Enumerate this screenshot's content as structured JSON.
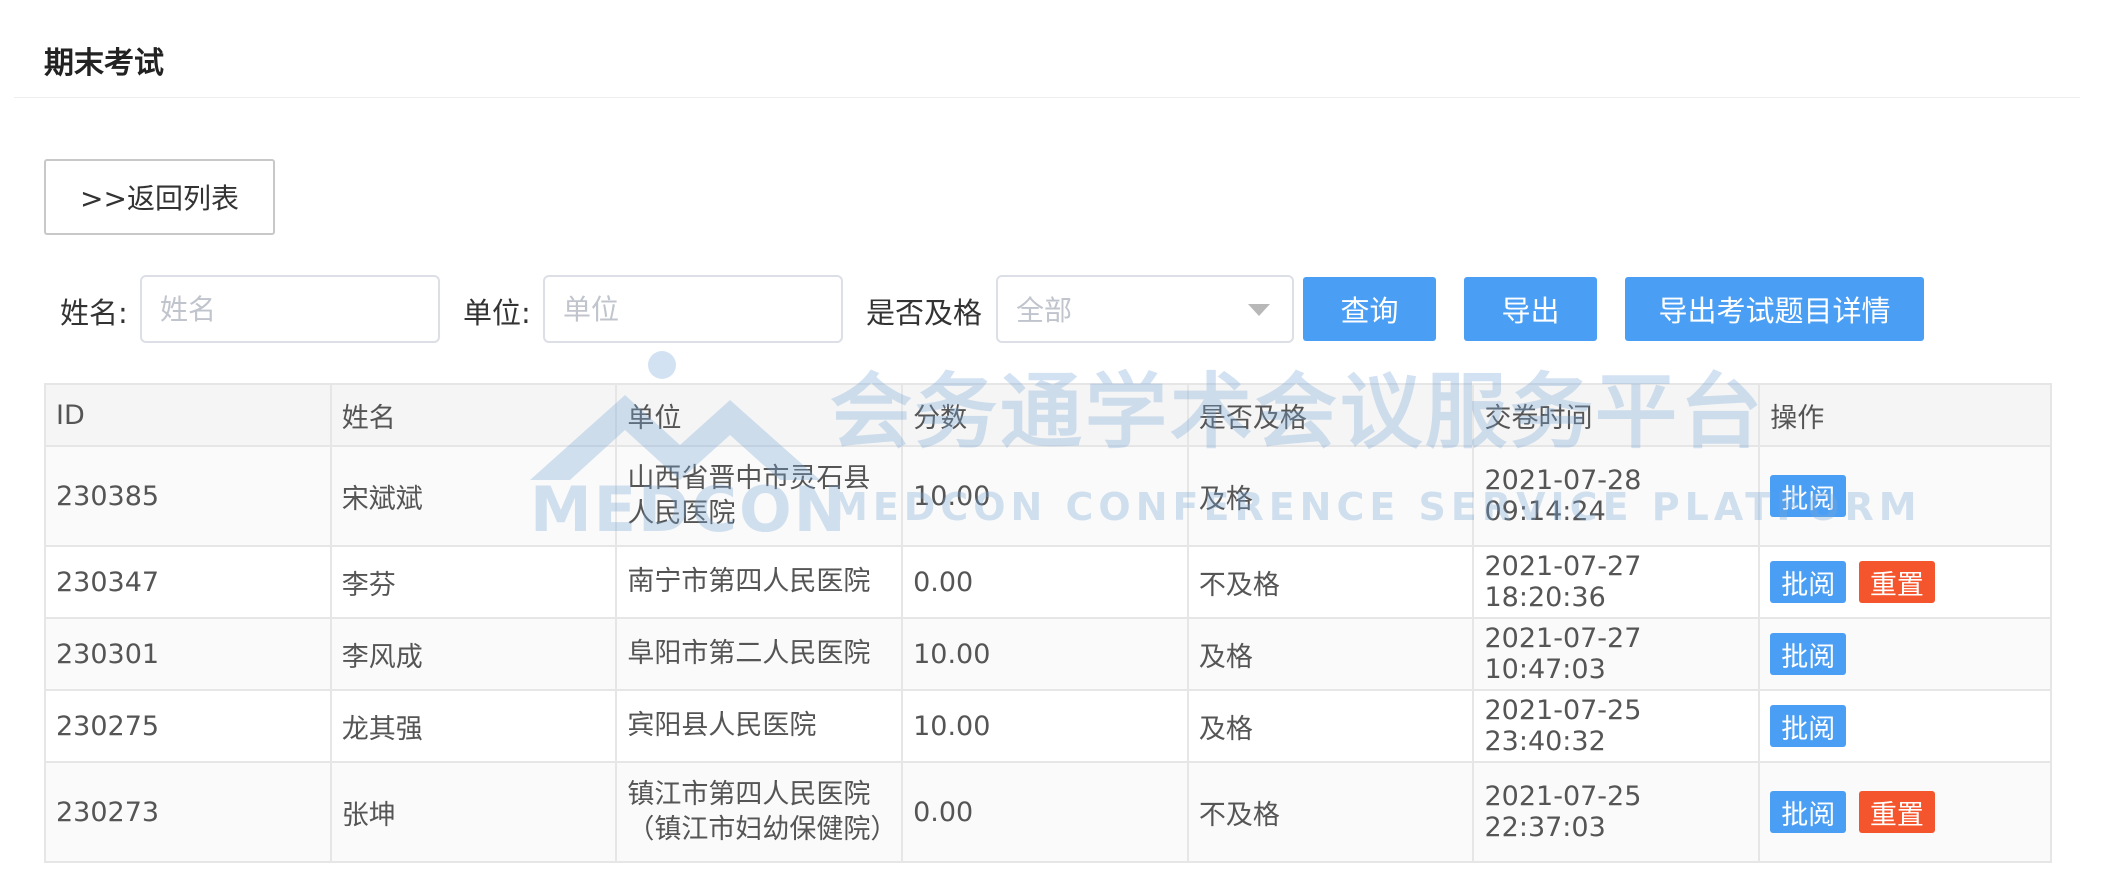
{
  "page": {
    "title": "期末考试"
  },
  "toolbar": {
    "back_label": ">>返回列表"
  },
  "filters": {
    "name_label": "姓名:",
    "name_placeholder": "姓名",
    "unit_label": "单位:",
    "unit_placeholder": "单位",
    "pass_label": "是否及格",
    "pass_selected": "全部",
    "query_label": "查询",
    "export_label": "导出",
    "export_detail_label": "导出考试题目详情"
  },
  "table": {
    "headers": [
      "ID",
      "姓名",
      "单位",
      "分数",
      "是否及格",
      "交卷时间",
      "操作"
    ],
    "rows": [
      {
        "id": "230385",
        "name": "宋斌斌",
        "unit": "山西省晋中市灵石县人民医院",
        "score": "10.00",
        "passed": "及格",
        "time": "2021-07-28 09:14:24",
        "actions": [
          "批阅"
        ]
      },
      {
        "id": "230347",
        "name": "李芬",
        "unit": "南宁市第四人民医院",
        "score": "0.00",
        "passed": "不及格",
        "time": "2021-07-27 18:20:36",
        "actions": [
          "批阅",
          "重置"
        ]
      },
      {
        "id": "230301",
        "name": "李风成",
        "unit": "阜阳市第二人民医院",
        "score": "10.00",
        "passed": "及格",
        "time": "2021-07-27 10:47:03",
        "actions": [
          "批阅"
        ]
      },
      {
        "id": "230275",
        "name": "龙其强",
        "unit": "宾阳县人民医院",
        "score": "10.00",
        "passed": "及格",
        "time": "2021-07-25 23:40:32",
        "actions": [
          "批阅"
        ]
      },
      {
        "id": "230273",
        "name": "张坤",
        "unit": "镇江市第四人民医院（镇江市妇幼保健院）",
        "score": "0.00",
        "passed": "不及格",
        "time": "2021-07-25 22:37:03",
        "actions": [
          "批阅",
          "重置"
        ]
      }
    ]
  },
  "watermark": {
    "logo_text": "MEDCON",
    "cn_text": "会务通学术会议服务平台",
    "en_text": "MEDCON CONFERENCE SERVICE PLATFORM"
  },
  "colors": {
    "primary": "#4a9ff5",
    "danger": "#f4552c",
    "watermark": "#7aa8d8"
  }
}
